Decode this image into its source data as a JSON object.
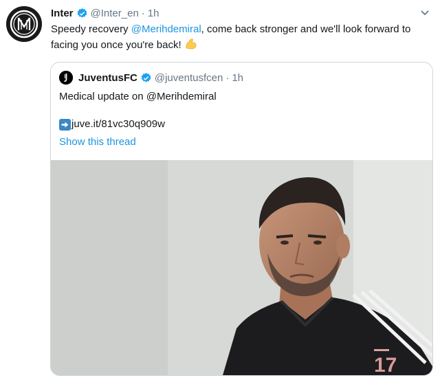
{
  "tweet": {
    "name": "Inter",
    "handle": "@Inter_en",
    "separator": "·",
    "time": "1h",
    "text_before": "Speedy recovery ",
    "mention": "@Merihdemiral",
    "text_after": ", come back stronger and we'll look forward to facing you once you're back!",
    "emoji": "flexed-biceps"
  },
  "quoted": {
    "name": "JuventusFC",
    "handle": "@juventusfcen",
    "separator": "·",
    "time": "1h",
    "text": "Medical update on @Merihdemiral",
    "link": "juve.it/81vc30q909w",
    "show_thread": "Show this thread"
  },
  "photo": {
    "shirt_number": "17"
  },
  "colors": {
    "link": "#1b95e0",
    "verified": "#1da1f2",
    "muted": "#657786",
    "border": "#ccd6dd"
  }
}
